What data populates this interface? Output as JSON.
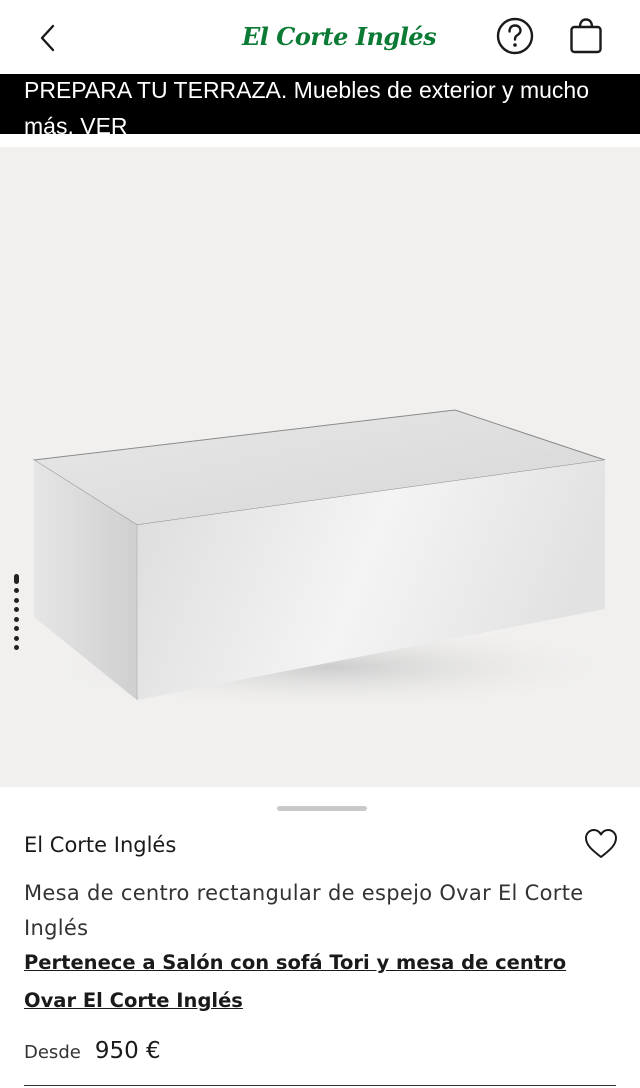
{
  "header": {
    "logo_text": "El Corte Inglés",
    "back_icon": "chevron-left-icon",
    "help_icon": "question-circle-icon",
    "bag_icon": "shopping-bag-icon",
    "brand_color": "#0b7a34"
  },
  "promo": {
    "text": "PREPARA TU TERRAZA. Muebles de exterior y mucho más. VER",
    "background": "#000000"
  },
  "gallery": {
    "image_count": 8,
    "active_index": 0,
    "background": "#f1f0ef"
  },
  "product": {
    "brand": "El Corte Inglés",
    "title": "Mesa de centro rectangular de espejo Ovar El Corte Inglés",
    "set_link": "Pertenece a Salón con sofá Tori y mesa de centro Ovar El Corte Inglés",
    "price_label": "Desde",
    "price": "950 €",
    "favorite_icon": "heart-outline-icon"
  }
}
